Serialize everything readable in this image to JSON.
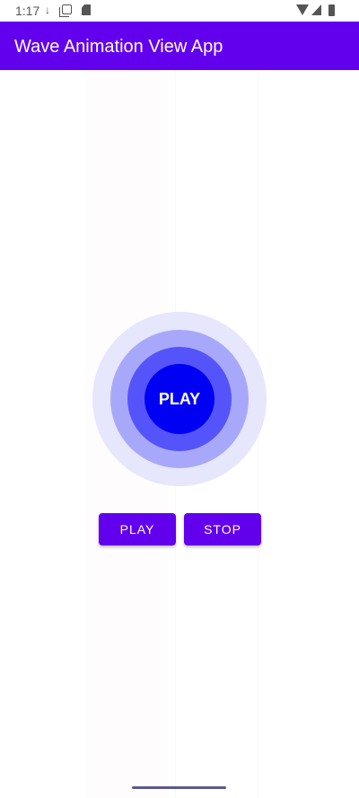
{
  "status_bar": {
    "time": "1:17",
    "icons": [
      "usb-icon",
      "copy-icon",
      "sd-card-icon",
      "wifi-icon",
      "signal-icon",
      "battery-icon"
    ]
  },
  "app_bar": {
    "title": "Wave Animation View App",
    "background": "#6200ee"
  },
  "wave_view": {
    "center_label": "PLAY",
    "colors": [
      "#0000f2",
      "#5454fa",
      "#a8a8fa",
      "#e6e6fc"
    ]
  },
  "buttons": {
    "play_label": "PLAY",
    "stop_label": "STOP"
  }
}
